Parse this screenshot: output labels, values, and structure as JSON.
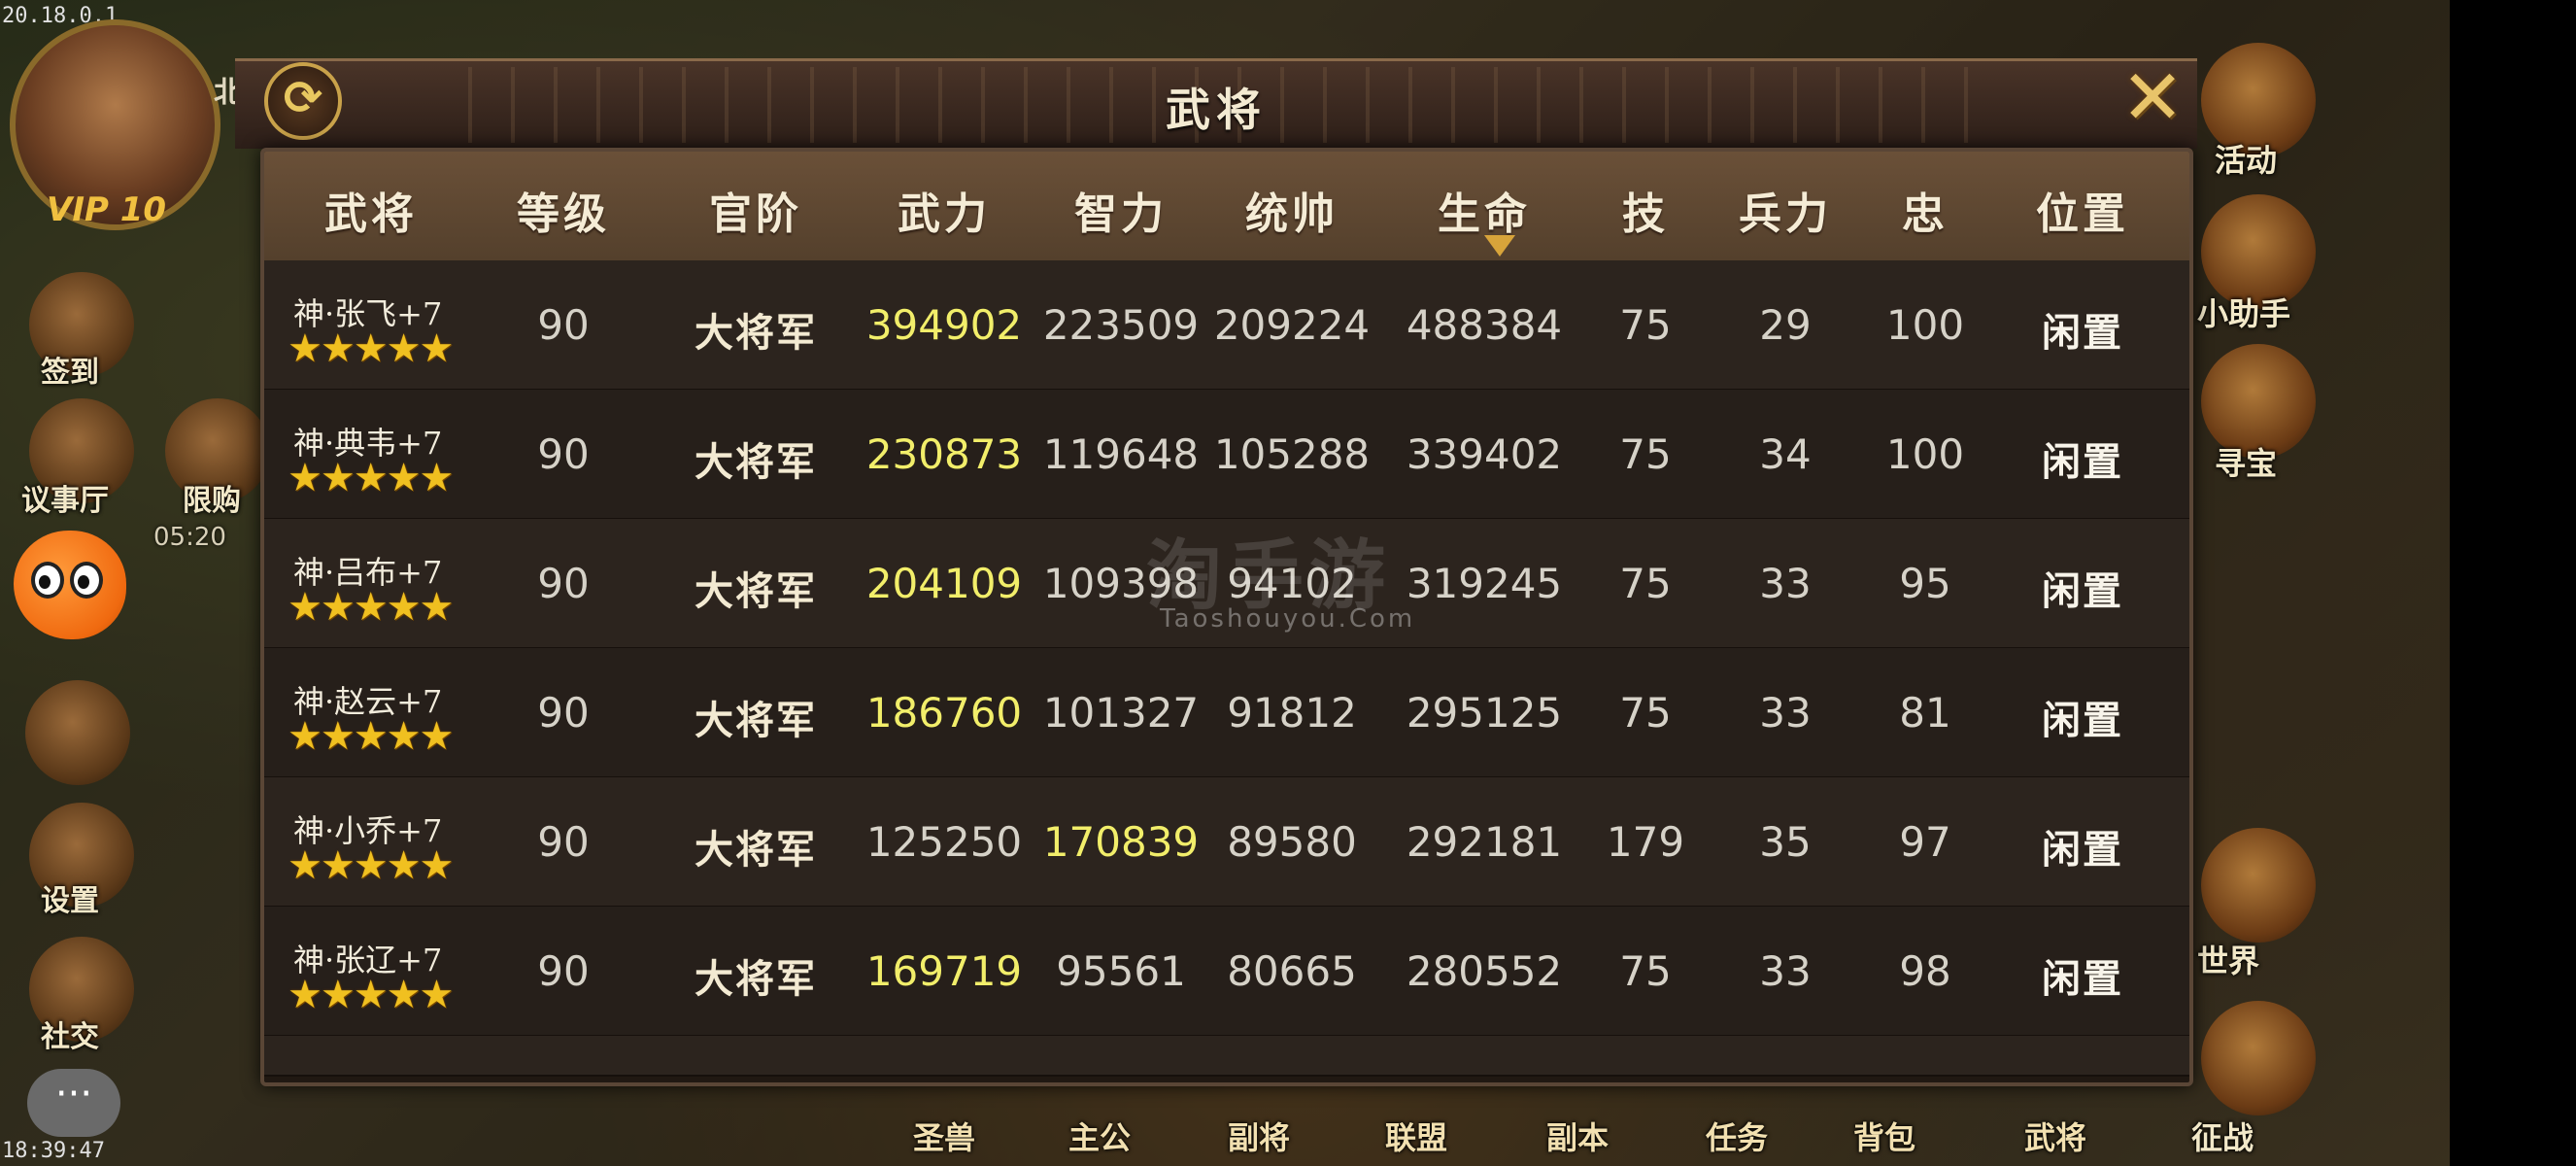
{
  "status": {
    "version": "20.18.0.1",
    "clock": "18:39:47"
  },
  "hud": {
    "vip": "VIP 10",
    "north_tab": "北",
    "left_labels": [
      "签到",
      "议事厅",
      "限购",
      "设置",
      "社交"
    ],
    "left_timer": "05:20",
    "right_labels": [
      "活动",
      "小助手",
      "寻宝",
      "世界",
      "征战"
    ],
    "bottom_nav": [
      "圣兽",
      "主公",
      "副将",
      "联盟",
      "副本",
      "任务",
      "背包",
      "武将"
    ]
  },
  "dialog": {
    "title": "武将",
    "columns": [
      "武将",
      "等级",
      "官阶",
      "武力",
      "智力",
      "统帅",
      "生命",
      "技",
      "兵力",
      "忠",
      "位置"
    ],
    "sorted_column": "生命",
    "rows": [
      {
        "name": "神·张飞+7",
        "stars": 5,
        "level": "90",
        "rank": "大将军",
        "force": "394902",
        "intellect": "223509",
        "command": "209224",
        "life": "488384",
        "skill": "75",
        "troops": "29",
        "loyalty": "100",
        "position": "闲置",
        "highlight": "force"
      },
      {
        "name": "神·典韦+7",
        "stars": 5,
        "level": "90",
        "rank": "大将军",
        "force": "230873",
        "intellect": "119648",
        "command": "105288",
        "life": "339402",
        "skill": "75",
        "troops": "34",
        "loyalty": "100",
        "position": "闲置",
        "highlight": "force"
      },
      {
        "name": "神·吕布+7",
        "stars": 5,
        "level": "90",
        "rank": "大将军",
        "force": "204109",
        "intellect": "109398",
        "command": "94102",
        "life": "319245",
        "skill": "75",
        "troops": "33",
        "loyalty": "95",
        "position": "闲置",
        "highlight": "force"
      },
      {
        "name": "神·赵云+7",
        "stars": 5,
        "level": "90",
        "rank": "大将军",
        "force": "186760",
        "intellect": "101327",
        "command": "91812",
        "life": "295125",
        "skill": "75",
        "troops": "33",
        "loyalty": "81",
        "position": "闲置",
        "highlight": "force"
      },
      {
        "name": "神·小乔+7",
        "stars": 5,
        "level": "90",
        "rank": "大将军",
        "force": "125250",
        "intellect": "170839",
        "command": "89580",
        "life": "292181",
        "skill": "179",
        "troops": "35",
        "loyalty": "97",
        "position": "闲置",
        "highlight": "intellect"
      },
      {
        "name": "神·张辽+7",
        "stars": 5,
        "level": "90",
        "rank": "大将军",
        "force": "169719",
        "intellect": "95561",
        "command": "80665",
        "life": "280552",
        "skill": "75",
        "troops": "33",
        "loyalty": "98",
        "position": "闲置",
        "highlight": "force"
      }
    ]
  },
  "watermark": {
    "main": "淘手游",
    "sub": "Taoshouyou.Com"
  },
  "colors": {
    "highlight": "#f2ee6a",
    "star": "#f0c020",
    "header_bg": "#5e4832"
  }
}
